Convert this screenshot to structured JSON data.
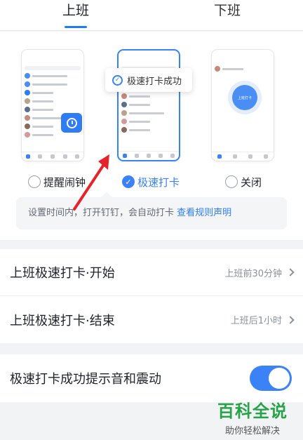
{
  "tabs": {
    "clock_in": "上班",
    "clock_out": "下班"
  },
  "modes": {
    "toast_text": "极速打卡成功",
    "punch_button_text": "上班打卡",
    "options": [
      "提醒闹钟",
      "极速打卡",
      "关闭"
    ],
    "selected": "极速打卡"
  },
  "tip": {
    "text": "设置时间内，打开钉钉，会自动打卡",
    "link": "查看规则声明"
  },
  "settings": [
    {
      "label": "上班极速打卡·开始",
      "value": "上班前30分钟"
    },
    {
      "label": "上班极速打卡·结束",
      "value": "上班后1小时"
    }
  ],
  "sound": {
    "label": "极速打卡成功提示音和震动",
    "enabled": true
  },
  "watermark": {
    "main": "百科全说",
    "sub": "助你轻松解决"
  },
  "colors": {
    "accent": "#3b82f6",
    "annotation": "#e5232a",
    "watermark": "#26a248"
  }
}
